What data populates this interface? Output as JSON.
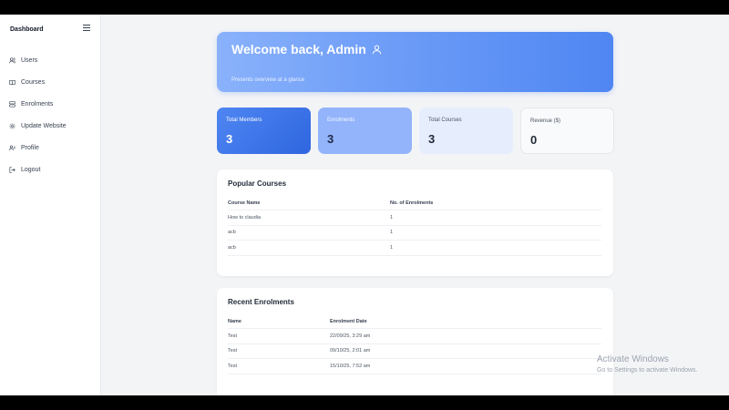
{
  "sidebar": {
    "brand": "Dashboard",
    "items": [
      {
        "label": "Users",
        "icon": "users-icon"
      },
      {
        "label": "Courses",
        "icon": "book-icon"
      },
      {
        "label": "Enrolments",
        "icon": "list-icon"
      },
      {
        "label": "Update Website",
        "icon": "gear-icon"
      },
      {
        "label": "Profile",
        "icon": "profile-icon"
      },
      {
        "label": "Logout",
        "icon": "logout-icon"
      }
    ]
  },
  "hero": {
    "title": "Welcome back, Admin",
    "subtitle": "Presents overview at a glance"
  },
  "stats": [
    {
      "label": "Total Members",
      "value": "3"
    },
    {
      "label": "Enrolments",
      "value": "3"
    },
    {
      "label": "Total Courses",
      "value": "3"
    },
    {
      "label": "Revenue ($)",
      "value": "0"
    }
  ],
  "popular_courses": {
    "title": "Popular Courses",
    "headers": [
      "Course Name",
      "No. of Enrolments"
    ],
    "rows": [
      [
        "How to claudia",
        "1"
      ],
      [
        "acb",
        "1"
      ],
      [
        "acb",
        "1"
      ]
    ]
  },
  "recent_enrolments": {
    "title": "Recent Enrolments",
    "headers": [
      "Name",
      "Enrolment Date"
    ],
    "rows": [
      [
        "Test",
        "22/09/25, 3:29 am"
      ],
      [
        "Test",
        "09/10/25, 2:01 am"
      ],
      [
        "Test",
        "15/10/25, 7:52 am"
      ]
    ]
  },
  "watermark": {
    "line1": "Activate Windows",
    "line2": "Go to Settings to activate Windows."
  }
}
